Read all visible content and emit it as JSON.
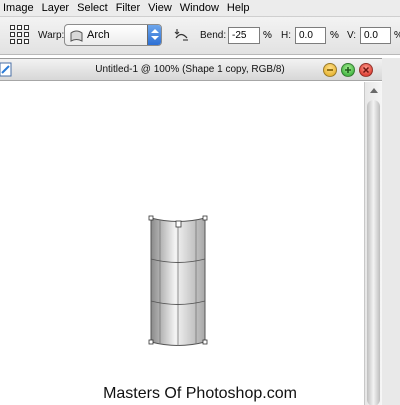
{
  "menubar": {
    "items": [
      "Image",
      "Layer",
      "Select",
      "Filter",
      "View",
      "Window",
      "Help"
    ]
  },
  "options_bar": {
    "warp_label": "Warp:",
    "warp_style": "Arch",
    "bend_label": "Bend:",
    "bend_value": "-25",
    "h_label": "H:",
    "h_value": "0.0",
    "v_label": "V:",
    "v_value": "0.0",
    "percent": "%",
    "icons": [
      "warp-mode-grid-icon",
      "arch-style-icon",
      "change-orientation-icon"
    ]
  },
  "document": {
    "title": "Untitled-1 @ 100% (Shape 1 copy, RGB/8)",
    "icons": [
      "document-icon",
      "minimize-icon",
      "zoom-icon",
      "close-icon"
    ],
    "window_buttons_colors": {
      "minimize": "#e9b83a",
      "zoom": "#49b947",
      "close": "#e0453a"
    }
  },
  "canvas": {
    "shape": "warped-shape-arch",
    "fill_colors": [
      "#8a8a8a",
      "#f4f4f4",
      "#a8a8a8"
    ]
  },
  "watermark": "Masters Of Photoshop.com"
}
